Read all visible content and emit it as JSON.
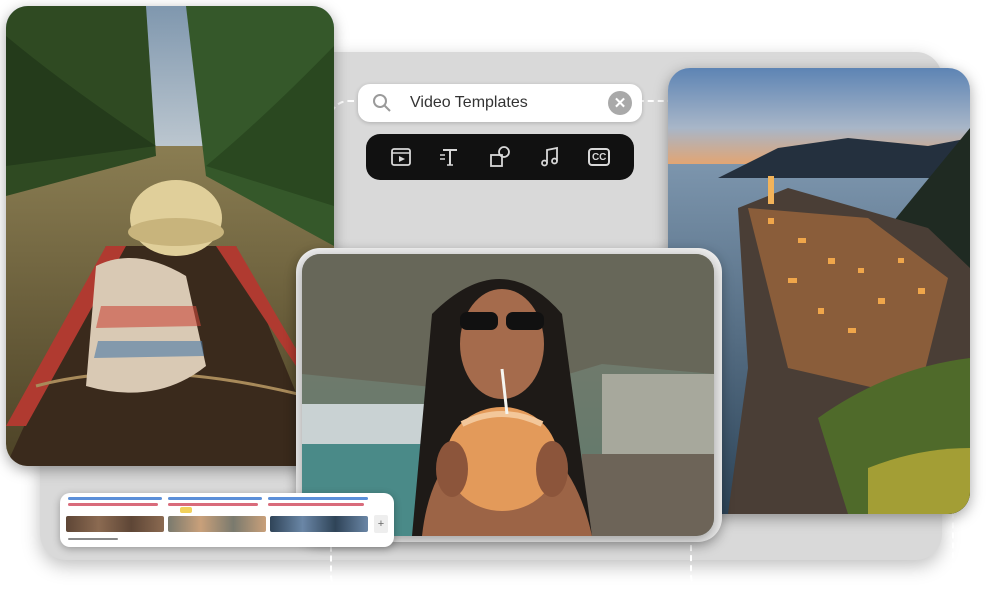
{
  "search": {
    "value": "Video Templates",
    "icon": "search-icon",
    "clear_icon": "close-icon",
    "clear_glyph": "✕"
  },
  "toolbar": {
    "items": [
      {
        "name": "video-template-tool",
        "icon": "film-icon"
      },
      {
        "name": "text-tool",
        "icon": "text-icon"
      },
      {
        "name": "elements-tool",
        "icon": "shapes-icon"
      },
      {
        "name": "audio-tool",
        "icon": "music-note-icon"
      },
      {
        "name": "captions-tool",
        "icon": "captions-icon",
        "label": "CC"
      }
    ]
  },
  "timeline": {
    "add_glyph": "+"
  },
  "colors": {
    "panel": "#d9d9d9",
    "toolbar_bg": "#111111",
    "timeline_blue": "#5b8fd9",
    "timeline_red": "#d96b7b",
    "marker_yellow": "#f1d15b"
  }
}
